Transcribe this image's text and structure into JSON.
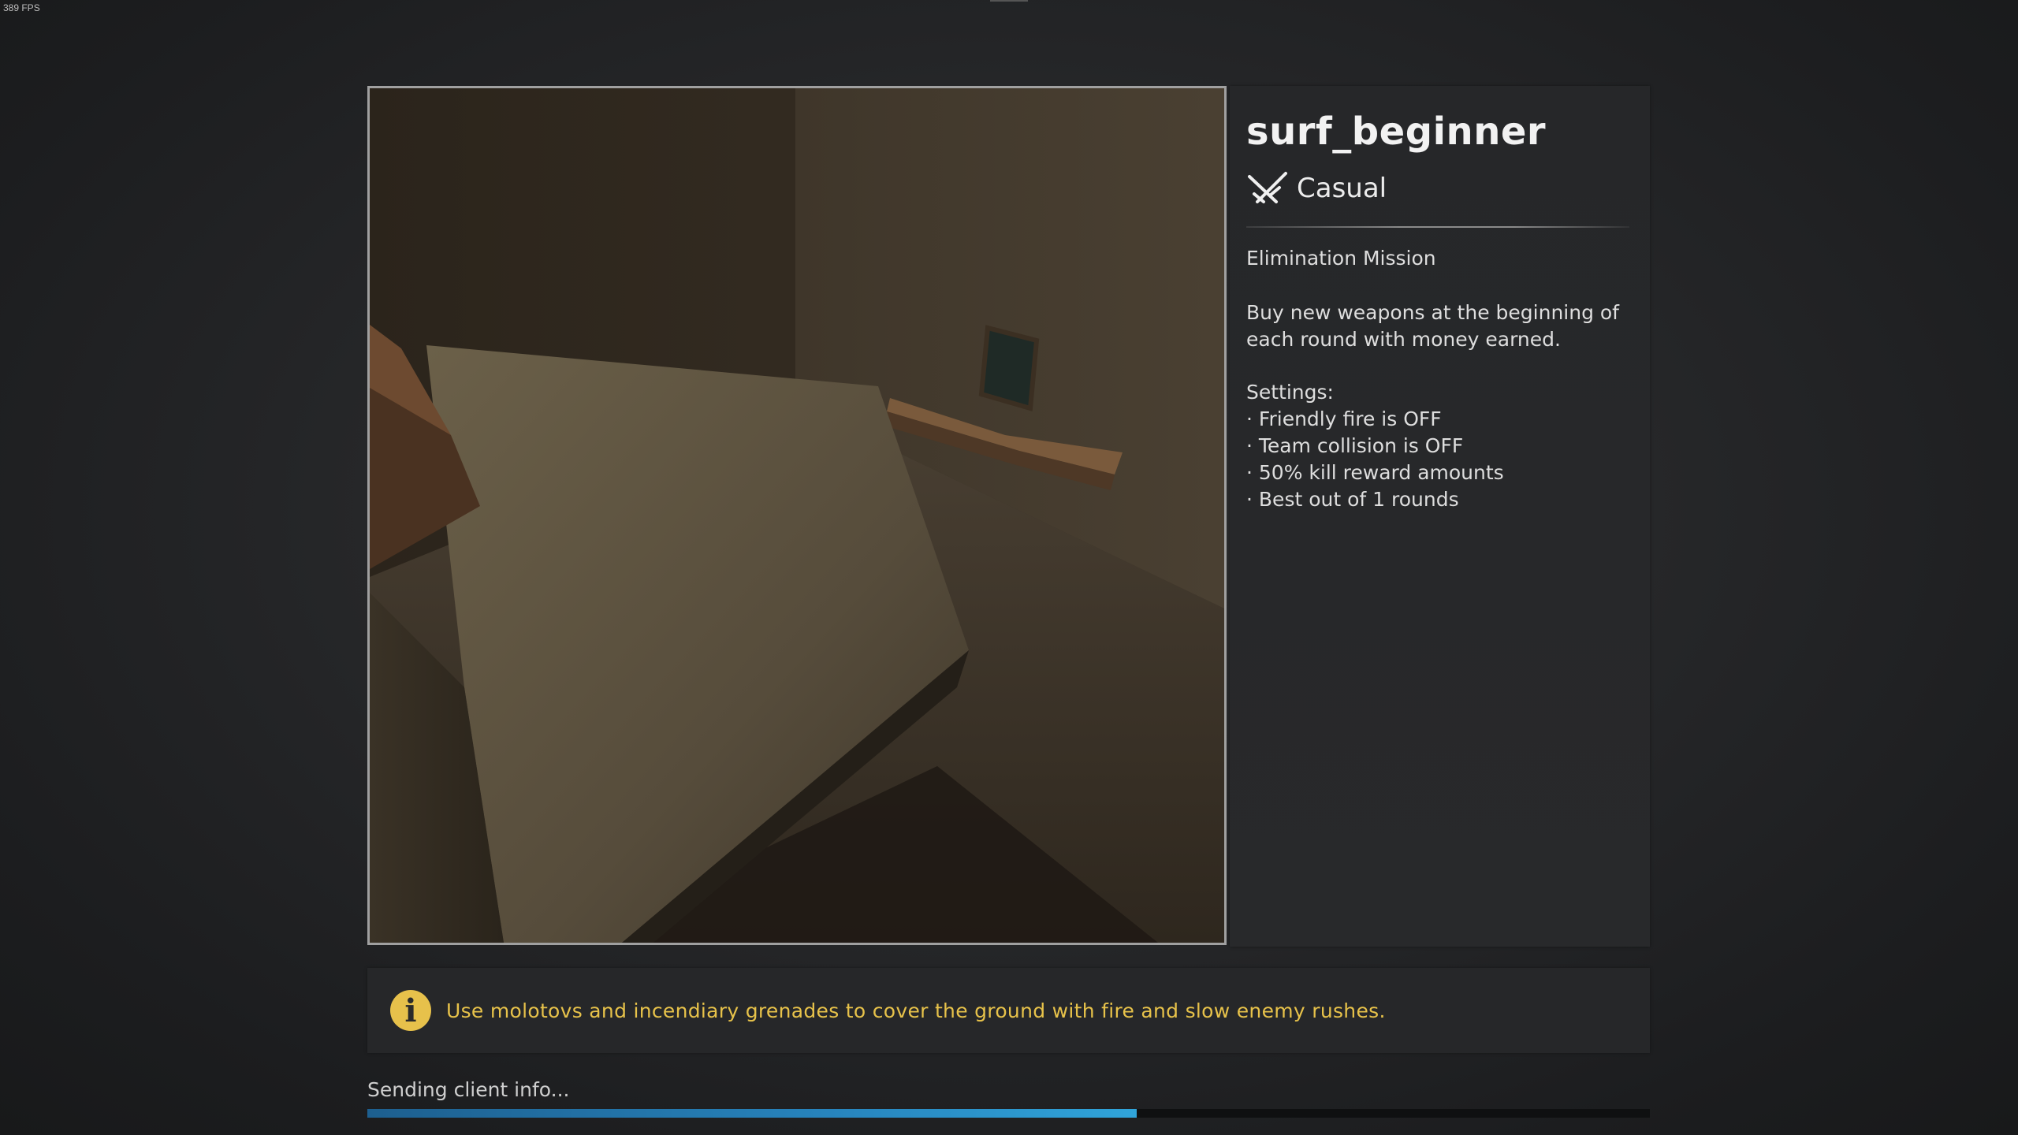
{
  "overlay": {
    "fps": "389 FPS"
  },
  "map": {
    "name": "surf_beginner",
    "mode_icon": "crossed-swords-icon",
    "mode": "Casual",
    "mission_title": "Elimination Mission",
    "description": "Buy new weapons at the beginning of each round with money earned.",
    "settings_label": "Settings:",
    "settings": [
      "Friendly fire is OFF",
      "Team collision is OFF",
      "50% kill reward amounts",
      "Best out of 1 rounds"
    ]
  },
  "tip": {
    "icon": "info-icon",
    "icon_glyph": "i",
    "text": "Use molotovs and incendiary grenades to cover the ground with fire and slow enemy rushes."
  },
  "loading": {
    "status": "Sending client info...",
    "progress": 0.6
  },
  "colors": {
    "tip_accent": "#e7c14b",
    "progress_fill": "#2a8fc8"
  }
}
